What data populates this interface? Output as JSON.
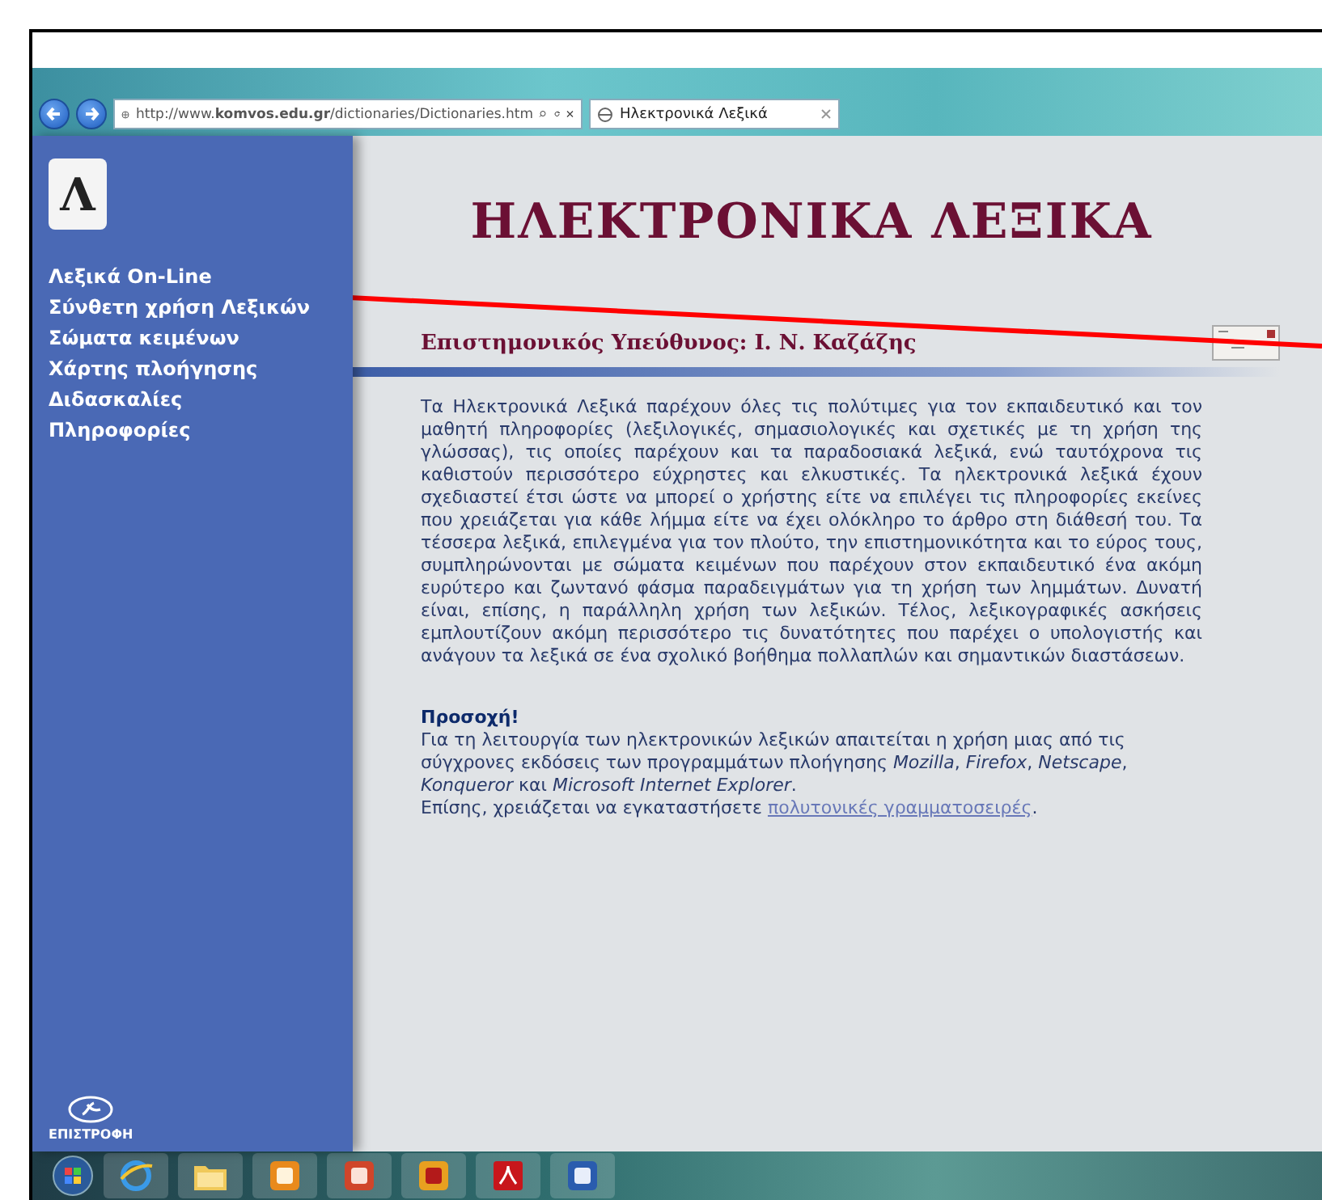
{
  "browser": {
    "address": "http://www.**komvos.edu.gr**/dictionaries/Dictionaries.htm",
    "tab": {
      "label": "Ηλεκτρονικά Λεξικά",
      "selected": true
    }
  },
  "sidebar": {
    "logo": "Λ",
    "items": [
      {
        "label": "Λεξικά On-Line",
        "selected": false
      },
      {
        "label": "Σύνθετη χρήση Λεξικών",
        "selected": false
      },
      {
        "label": "Σώματα κειμένων",
        "selected": false
      },
      {
        "label": "Χάρτης πλοήγησης",
        "selected": false
      },
      {
        "label": "Διδασκαλίες",
        "selected": false
      },
      {
        "label": "Πληροφορίες",
        "selected": false
      }
    ],
    "back": "ΕΠΙΣΤΡΟΦΗ"
  },
  "content": {
    "title": "ΗΛΕΚΤΡΟΝΙΚΑ ΛΕΞΙΚΑ",
    "subtitle": "Επιστημονικός Υπεύθυνος: Ι. Ν. Καζάζης",
    "intro": "Τα Ηλεκτρονικά Λεξικά παρέχουν όλες τις πολύτιμες για τον εκπαιδευτικό και τον μαθητή πληροφορίες (λεξιλογικές, σημασιολογικές και σχετικές με τη χρήση της γλώσσας), τις οποίες παρέχουν και τα παραδοσιακά λεξικά, ενώ ταυτόχρονα τις καθιστούν περισσότερο εύχρηστες και ελκυστικές. Τα ηλεκτρονικά λεξικά έχουν σχεδιαστεί έτσι ώστε να μπορεί ο χρήστης είτε να επιλέγει τις πληροφορίες εκείνες που χρειάζεται για κάθε λήμμα είτε να έχει ολόκληρο το άρθρο στη διάθεσή του. Τα τέσσερα λεξικά, επιλεγμένα για τον πλούτο, την επιστημονικότητα και το εύρος τους, συμπληρώνονται με σώματα κειμένων που παρέχουν στον εκπαιδευτικό ένα ακόμη ευρύτερο και ζωντανό φάσμα παραδειγμάτων για τη χρήση των λημμάτων. Δυνατή είναι, επίσης, η παράλληλη χρήση των λεξικών. Τέλος, λεξικογραφικές ασκήσεις εμπλουτίζουν ακόμη περισσότερο τις δυνατότητες που παρέχει ο υπολογιστής και ανάγουν τα λεξικά σε ένα σχολικό βοήθημα πολλαπλών και σημαντικών διαστάσεων.",
    "notice": {
      "heading": "Προσοχή!",
      "text": "Για τη λειτουργία των ηλεκτρονικών λεξικών απαιτείται η χρήση μιας από τις σύγχρονες εκδόσεις των προγραμμάτων πλοήγησης *Mozilla*, *Firefox*, *Netscape*, *Konqueror* και *Microsoft Internet Explorer*.",
      "install_text": "Επίσης, χρειάζεται να εγκαταστήσετε",
      "install_link": "πολυτονικές γραμματοσειρές",
      "install_end": "."
    }
  }
}
